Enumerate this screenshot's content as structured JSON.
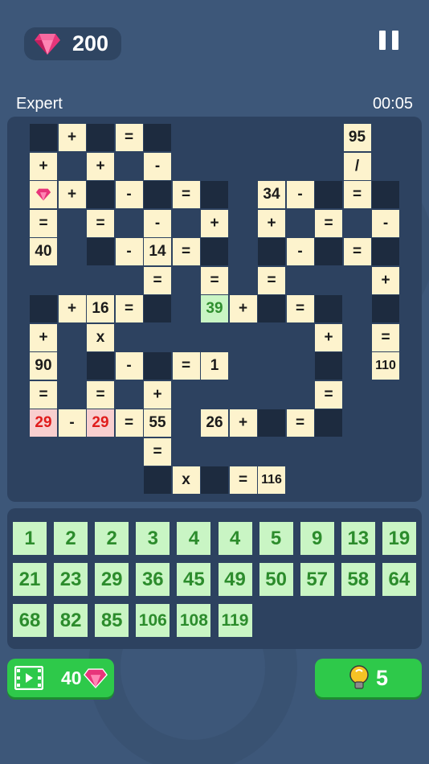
{
  "header": {
    "gems": "200",
    "difficulty": "Expert",
    "timer": "00:05"
  },
  "board": {
    "cells": [
      {
        "t": "blank",
        "v": ""
      },
      {
        "t": "op",
        "v": "+"
      },
      {
        "t": "blank",
        "v": ""
      },
      {
        "t": "op",
        "v": "="
      },
      {
        "t": "blank",
        "v": ""
      },
      {
        "t": "num",
        "v": "95"
      },
      {
        "t": "op",
        "v": "+"
      },
      {
        "t": "op",
        "v": "+"
      },
      {
        "t": "op",
        "v": "-"
      },
      {
        "t": "op",
        "v": "/"
      },
      {
        "t": "gem",
        "v": ""
      },
      {
        "t": "op",
        "v": "+"
      },
      {
        "t": "blank",
        "v": ""
      },
      {
        "t": "op",
        "v": "-"
      },
      {
        "t": "blank",
        "v": ""
      },
      {
        "t": "op",
        "v": "="
      },
      {
        "t": "blank",
        "v": ""
      },
      {
        "t": "num",
        "v": "34"
      },
      {
        "t": "op",
        "v": "-"
      },
      {
        "t": "blank",
        "v": ""
      },
      {
        "t": "op",
        "v": "="
      },
      {
        "t": "blank",
        "v": ""
      },
      {
        "t": "op",
        "v": "="
      },
      {
        "t": "op",
        "v": "="
      },
      {
        "t": "op",
        "v": "-"
      },
      {
        "t": "op",
        "v": "+"
      },
      {
        "t": "op",
        "v": "+"
      },
      {
        "t": "op",
        "v": "="
      },
      {
        "t": "op",
        "v": "-"
      },
      {
        "t": "num",
        "v": "40"
      },
      {
        "t": "blank",
        "v": ""
      },
      {
        "t": "op",
        "v": "-"
      },
      {
        "t": "num",
        "v": "14"
      },
      {
        "t": "op",
        "v": "="
      },
      {
        "t": "blank",
        "v": ""
      },
      {
        "t": "blank",
        "v": ""
      },
      {
        "t": "op",
        "v": "-"
      },
      {
        "t": "blank",
        "v": ""
      },
      {
        "t": "op",
        "v": "="
      },
      {
        "t": "blank",
        "v": ""
      },
      {
        "t": "op",
        "v": "="
      },
      {
        "t": "op",
        "v": "="
      },
      {
        "t": "op",
        "v": "="
      },
      {
        "t": "op",
        "v": "+"
      },
      {
        "t": "blank",
        "v": ""
      },
      {
        "t": "op",
        "v": "+"
      },
      {
        "t": "num",
        "v": "16"
      },
      {
        "t": "op",
        "v": "="
      },
      {
        "t": "blank",
        "v": ""
      },
      {
        "t": "correct",
        "v": "39"
      },
      {
        "t": "op",
        "v": "+"
      },
      {
        "t": "blank",
        "v": ""
      },
      {
        "t": "op",
        "v": "="
      },
      {
        "t": "blank",
        "v": ""
      },
      {
        "t": "blank",
        "v": ""
      },
      {
        "t": "op",
        "v": "+"
      },
      {
        "t": "op",
        "v": "x"
      },
      {
        "t": "op",
        "v": "+"
      },
      {
        "t": "op",
        "v": "="
      },
      {
        "t": "num",
        "v": "90"
      },
      {
        "t": "blank",
        "v": ""
      },
      {
        "t": "op",
        "v": "-"
      },
      {
        "t": "blank",
        "v": ""
      },
      {
        "t": "op",
        "v": "="
      },
      {
        "t": "num",
        "v": "1"
      },
      {
        "t": "blank",
        "v": ""
      },
      {
        "t": "num",
        "v": "110"
      },
      {
        "t": "op",
        "v": "="
      },
      {
        "t": "op",
        "v": "="
      },
      {
        "t": "op",
        "v": "+"
      },
      {
        "t": "op",
        "v": "="
      },
      {
        "t": "wrong",
        "v": "29"
      },
      {
        "t": "op",
        "v": "-"
      },
      {
        "t": "wrong",
        "v": "29"
      },
      {
        "t": "op",
        "v": "="
      },
      {
        "t": "num",
        "v": "55"
      },
      {
        "t": "num",
        "v": "26"
      },
      {
        "t": "op",
        "v": "+"
      },
      {
        "t": "blank",
        "v": ""
      },
      {
        "t": "op",
        "v": "="
      },
      {
        "t": "blank",
        "v": ""
      },
      {
        "t": "op",
        "v": "="
      },
      {
        "t": "blank",
        "v": ""
      },
      {
        "t": "op",
        "v": "x"
      },
      {
        "t": "blank",
        "v": ""
      },
      {
        "t": "op",
        "v": "="
      },
      {
        "t": "num",
        "v": "116"
      }
    ]
  },
  "number_bank": [
    "1",
    "2",
    "2",
    "3",
    "4",
    "4",
    "5",
    "9",
    "13",
    "19",
    "21",
    "23",
    "29",
    "36",
    "45",
    "49",
    "50",
    "57",
    "58",
    "64",
    "68",
    "82",
    "85",
    "106",
    "108",
    "119"
  ],
  "footer": {
    "video_reward": "40",
    "hints": "5"
  },
  "colors": {
    "background": "#3d5779",
    "panel": "#2d4260",
    "cell": "#fdf3cd",
    "blank_cell": "#1d2b3f",
    "correct": "#c9f5c4",
    "wrong": "#f8cfcf",
    "button_green": "#2ec94a",
    "gem_pink": "#e8357a"
  }
}
